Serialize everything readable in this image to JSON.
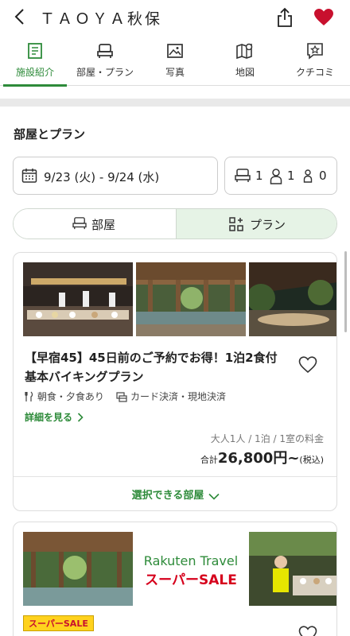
{
  "header": {
    "title": "ＴＡＯＹＡ秋保",
    "back_icon": "chevron-left-icon",
    "share_icon": "share-icon",
    "favorite_icon": "heart-filled-icon",
    "favorite_color": "#c8102e"
  },
  "tabs": [
    {
      "label": "施設紹介",
      "icon": "info-page-icon",
      "active": true
    },
    {
      "label": "部屋・プラン",
      "icon": "bed-icon",
      "active": false
    },
    {
      "label": "写真",
      "icon": "photo-icon",
      "active": false
    },
    {
      "label": "地図",
      "icon": "map-icon",
      "active": false
    },
    {
      "label": "クチコミ",
      "icon": "review-star-icon",
      "active": false
    }
  ],
  "accent_color": "#2e8b3a",
  "rooms_plans": {
    "title": "部屋とプラン",
    "dates": "9/23 (火) - 9/24 (水)",
    "guests": {
      "rooms": "1",
      "adults": "1",
      "children": "0"
    },
    "toggle": {
      "rooms_label": "部屋",
      "plans_label": "プラン",
      "selected": "plans"
    }
  },
  "plan1": {
    "title": "【早宿45】45日前のご予約でお得！1泊2食付 基本バイキングプラン",
    "meals": "朝食・夕食あり",
    "payment": "カード決済・現地決済",
    "details_link": "詳細を見る",
    "price_note": "大人1人 / 1泊 / 1室の料金",
    "price_prefix": "合計",
    "price": "26,800円~",
    "price_suffix": "(税込)",
    "rooms_button": "選択できる部屋"
  },
  "plan2": {
    "banner_brand": "Rakuten Travel",
    "banner_sale": "スーパーSALE",
    "badge": "スーパーSALE"
  }
}
